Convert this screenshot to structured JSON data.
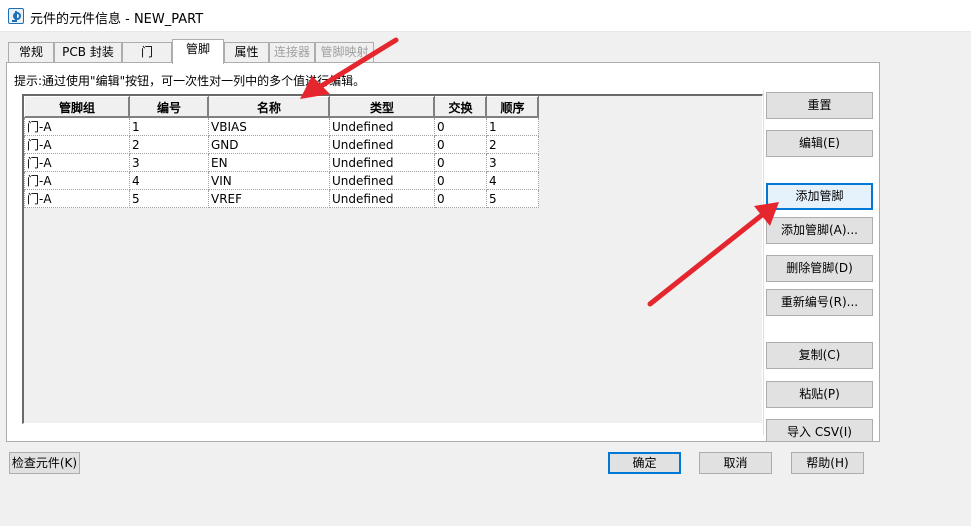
{
  "window": {
    "title": "元件的元件信息 - NEW_PART"
  },
  "tabs": [
    {
      "label": "常规",
      "state": "normal"
    },
    {
      "label": "PCB 封装",
      "state": "normal"
    },
    {
      "label": "门",
      "state": "normal"
    },
    {
      "label": "管脚",
      "state": "active"
    },
    {
      "label": "属性",
      "state": "normal"
    },
    {
      "label": "连接器",
      "state": "disabled"
    },
    {
      "label": "管脚映射",
      "state": "disabled"
    }
  ],
  "hint": "提示:通过使用\"编辑\"按钮，可一次性对一列中的多个值进行编辑。",
  "table": {
    "columns": [
      "管脚组",
      "编号",
      "名称",
      "类型",
      "交换",
      "顺序"
    ],
    "rows": [
      [
        "门-A",
        "1",
        "VBIAS",
        "Undefined",
        "0",
        "1"
      ],
      [
        "门-A",
        "2",
        "GND",
        "Undefined",
        "0",
        "2"
      ],
      [
        "门-A",
        "3",
        "EN",
        "Undefined",
        "0",
        "3"
      ],
      [
        "门-A",
        "4",
        "VIN",
        "Undefined",
        "0",
        "4"
      ],
      [
        "门-A",
        "5",
        "VREF",
        "Undefined",
        "0",
        "5"
      ]
    ]
  },
  "side_buttons": {
    "reset": "重置",
    "edit": "编辑(E)",
    "add_pin": "添加管脚",
    "add_pins": "添加管脚(A)...",
    "delete_pin": "删除管脚(D)",
    "renumber": "重新编号(R)...",
    "copy": "复制(C)",
    "paste": "粘贴(P)",
    "import_csv": "导入 CSV(I)"
  },
  "bottom_buttons": {
    "check": "检查元件(K)",
    "ok": "确定",
    "cancel": "取消",
    "help": "帮助(H)"
  },
  "colors": {
    "annotation_arrow": "#e5262e",
    "focus_blue": "#0078d7"
  }
}
